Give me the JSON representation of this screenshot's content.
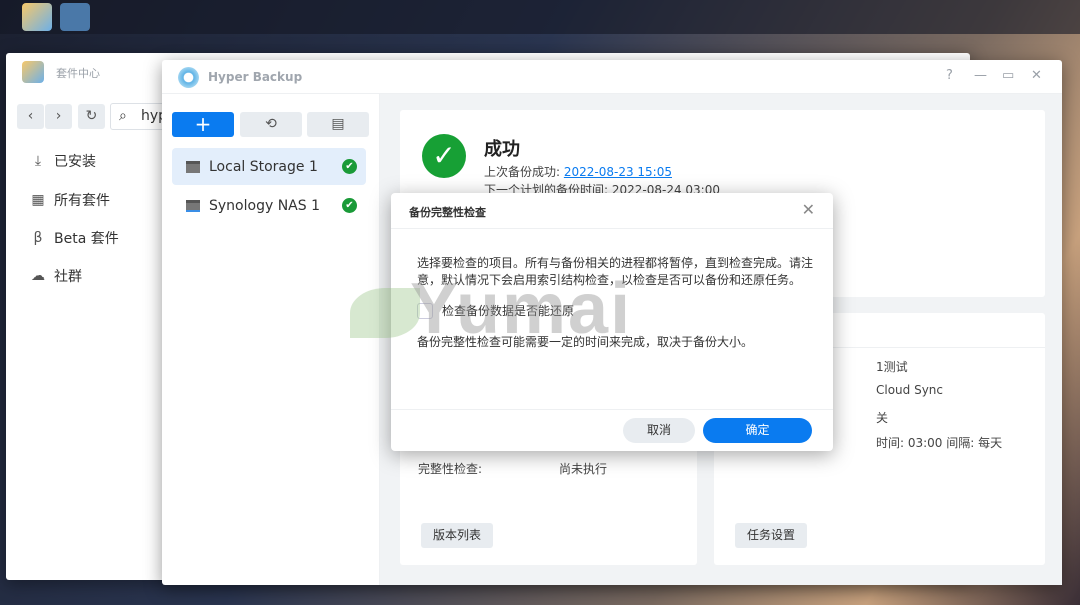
{
  "package_center": {
    "title": "套件中心",
    "search_value": "hyp",
    "nav": [
      {
        "label": "已安装",
        "icon": "download-icon"
      },
      {
        "label": "所有套件",
        "icon": "grid-icon"
      },
      {
        "label": "Beta 套件",
        "icon": "beta-icon"
      },
      {
        "label": "社群",
        "icon": "community-icon"
      }
    ]
  },
  "hyper_backup": {
    "title": "Hyper Backup",
    "window_controls": {
      "help": "?",
      "minimize": "—",
      "maximize": "▭",
      "close": "✕"
    },
    "toolbar": {
      "add": "+",
      "restore": "⟲",
      "log": "▤"
    },
    "tasks": [
      {
        "name": "Local Storage 1",
        "status": "success",
        "selected": true
      },
      {
        "name": "Synology NAS 1",
        "status": "success",
        "selected": false
      }
    ],
    "status": {
      "title": "成功",
      "last_label": "上次备份成功: ",
      "last_value": "2022-08-23 15:05",
      "next_label": "下一个计划的备份时间: ",
      "next_value": "2022-08-24 03:00"
    },
    "integrity": {
      "label": "完整性检查:",
      "value": "尚未执行"
    },
    "task_info_values": [
      "1测试",
      "Cloud Sync",
      "关",
      "时间: 03:00 间隔: 每天"
    ],
    "version_list_button": "版本列表",
    "task_settings_button": "任务设置"
  },
  "dialog": {
    "title": "备份完整性检查",
    "description": "选择要检查的项目。所有与备份相关的进程都将暂停，直到检查完成。请注意，默认情况下会启用索引结构检查，以检查是否可以备份和还原任务。",
    "checkbox_label": "检查备份数据是否能还原",
    "checkbox_checked": false,
    "note": "备份完整性检查可能需要一定的时间来完成，取决于备份大小。",
    "cancel": "取消",
    "ok": "确定"
  },
  "watermark": "Yumai",
  "colors": {
    "primary": "#0a7bf0",
    "success": "#17a035"
  }
}
